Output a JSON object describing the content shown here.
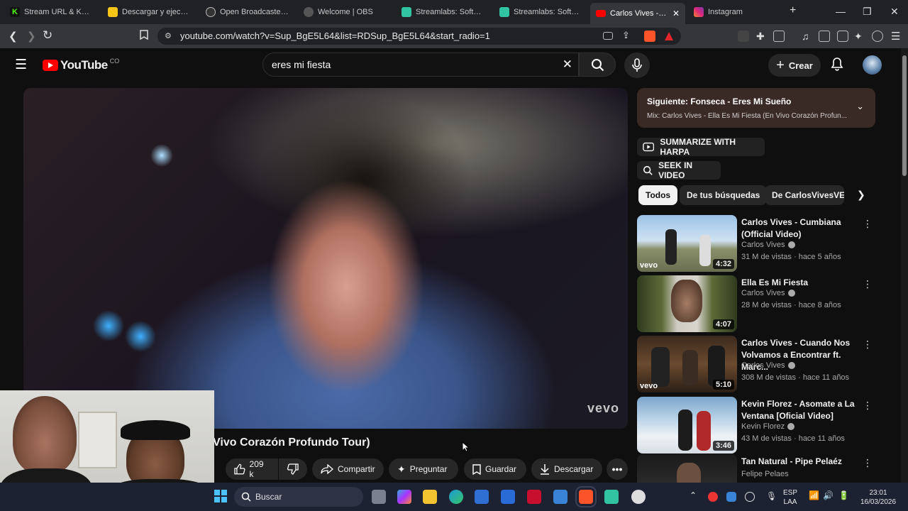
{
  "browser": {
    "tabs": [
      {
        "label": "Stream URL & Key - K",
        "color": "#53fc18"
      },
      {
        "label": "Descargar y ejecutar",
        "color": "#f5c518"
      },
      {
        "label": "Open Broadcaster Sof",
        "color": "#bbbbbb"
      },
      {
        "label": "Welcome | OBS",
        "color": "#bbbbbb"
      },
      {
        "label": "Streamlabs: Software",
        "color": "#31c3a2"
      },
      {
        "label": "Streamlabs: Software",
        "color": "#31c3a2"
      },
      {
        "label": "Carlos Vives - Ella",
        "color": "#ff0000"
      },
      {
        "label": "Instagram",
        "color": "#e1306c"
      }
    ],
    "new_tab": "+",
    "url": "youtube.com/watch?v=Sup_BgE5L64&list=RDSup_BgE5L64&start_radio=1"
  },
  "youtube": {
    "logo_text": "YouTube",
    "country": "CO",
    "search_value": "eres mi fiesta",
    "create_label": "Crear",
    "video_title": "Vivo Corazón Profundo Tour)",
    "watermark": "vevo",
    "actions": {
      "likes": "209 k",
      "share": "Compartir",
      "ask": "Preguntar",
      "save": "Guardar",
      "download": "Descargar"
    },
    "next_up": {
      "title": "Siguiente: Fonseca - Eres Mi Sueño",
      "subtitle": "Mix: Carlos Vives - Ella Es Mi Fiesta (En Vivo Corazón Profun..."
    },
    "harpa": {
      "summarize": "SUMMARIZE WITH HARPA",
      "seek": "SEEK IN VIDEO"
    },
    "chips": [
      "Todos",
      "De tus búsquedas",
      "De CarlosVivesVEVO"
    ],
    "related": [
      {
        "title": "Carlos Vives - Cumbiana (Official Video)",
        "channel": "Carlos Vives",
        "meta": "31 M de vistas · hace 5 años",
        "duration": "4:32",
        "vevo": "vevo"
      },
      {
        "title": "Ella Es Mi Fiesta",
        "channel": "Carlos Vives",
        "meta": "28 M de vistas · hace 8 años",
        "duration": "4:07",
        "vevo": ""
      },
      {
        "title": "Carlos Vives - Cuando Nos Volvamos a Encontrar ft. Marc...",
        "channel": "Carlos Vives",
        "meta": "308 M de vistas · hace 11 años",
        "duration": "5:10",
        "vevo": "vevo"
      },
      {
        "title": "Kevin Florez - Asomate a La Ventana [Oficial Video]",
        "channel": "Kevin Florez",
        "meta": "43 M de vistas · hace 11 años",
        "duration": "3:46",
        "vevo": ""
      },
      {
        "title": "Tan Natural - Pipe Pelaéz",
        "channel": "Felipe Pelaes",
        "meta": "",
        "duration": "",
        "vevo": ""
      }
    ]
  },
  "taskbar": {
    "search_placeholder": "Buscar",
    "lang_line1": "ESP",
    "lang_line2": "LAA",
    "time": "23:01",
    "date": "16/03/2026"
  }
}
